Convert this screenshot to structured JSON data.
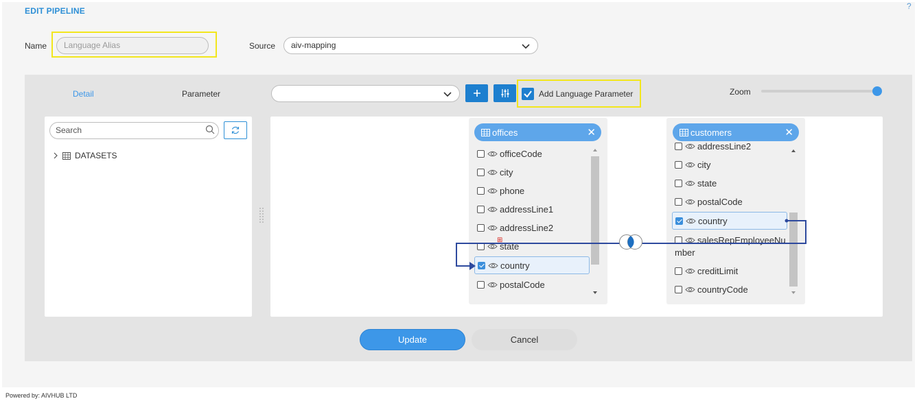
{
  "header": {
    "title": "EDIT PIPELINE",
    "help": "?"
  },
  "form": {
    "name_label": "Name",
    "name_placeholder": "Language Alias",
    "source_label": "Source",
    "source_value": "aiv-mapping"
  },
  "tabs": {
    "detail": "Detail",
    "parameter": "Parameter"
  },
  "toolbar": {
    "dropdown_value": "",
    "add_language_param_label": "Add Language Parameter",
    "add_language_param_checked": true,
    "zoom_label": "Zoom",
    "zoom_level": 1.0
  },
  "sidebar": {
    "search_placeholder": "Search",
    "tree_root": "DATASETS"
  },
  "tables": {
    "offices": {
      "title": "offices",
      "fields": [
        {
          "name": "officeCode",
          "checked": false
        },
        {
          "name": "city",
          "checked": false
        },
        {
          "name": "phone",
          "checked": false
        },
        {
          "name": "addressLine1",
          "checked": false
        },
        {
          "name": "addressLine2",
          "checked": false
        },
        {
          "name": "state",
          "checked": false
        },
        {
          "name": "country",
          "checked": true
        },
        {
          "name": "postalCode",
          "checked": false
        }
      ]
    },
    "customers": {
      "title": "customers",
      "fields": [
        {
          "name": "addressLine2",
          "checked": false
        },
        {
          "name": "city",
          "checked": false
        },
        {
          "name": "state",
          "checked": false
        },
        {
          "name": "postalCode",
          "checked": false
        },
        {
          "name": "country",
          "checked": true
        },
        {
          "name": "salesRepEmployeeNu",
          "continued": "mber",
          "checked": false
        },
        {
          "name": "creditLimit",
          "checked": false
        },
        {
          "name": "countryCode",
          "checked": false
        }
      ]
    }
  },
  "actions": {
    "update": "Update",
    "cancel": "Cancel"
  },
  "footer": {
    "text": "Powered by: AIVHUB LTD"
  },
  "colors": {
    "accent": "#1d7fcf",
    "highlight": "#f2e61c",
    "table_header": "#5ea6ea",
    "join_line": "#2e4a9e"
  }
}
